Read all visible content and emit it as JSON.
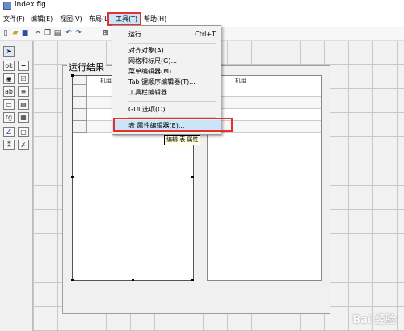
{
  "window": {
    "title": "index.fig"
  },
  "menubar": {
    "items": [
      "文件(F)",
      "编辑(E)",
      "视图(V)",
      "布局(L)",
      "工具(T)",
      "帮助(H)"
    ]
  },
  "tools_menu": {
    "items": [
      {
        "label": "运行",
        "shortcut": "Ctrl+T"
      },
      {
        "label": "对齐对象(A)..."
      },
      {
        "label": "网格和标尺(G)..."
      },
      {
        "label": "菜单编辑器(M)..."
      },
      {
        "label": "Tab 键顺序编辑器(T)..."
      },
      {
        "label": "工具栏编辑器..."
      },
      {
        "label": "GUI 选项(O)..."
      },
      {
        "label": "表 属性编辑器(E)..."
      }
    ],
    "tooltip": "编辑 表 属性"
  },
  "panel": {
    "title": "运行结果"
  },
  "tables": [
    {
      "column_header": "机组"
    },
    {
      "column_header": "机组"
    }
  ],
  "watermark": "Bai 经验"
}
